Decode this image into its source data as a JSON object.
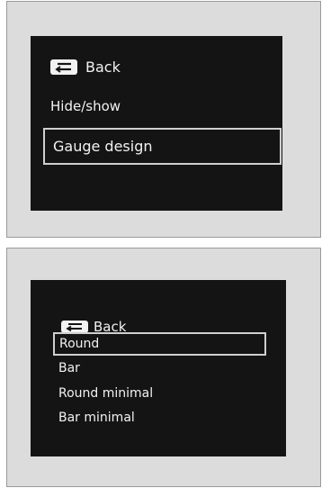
{
  "panel_1": {
    "back_label": "Back",
    "items": [
      "Hide/show",
      "Gauge design"
    ],
    "selected": "Gauge design"
  },
  "panel_2": {
    "back_label": "Back",
    "items": [
      "Round",
      "Bar",
      "Round minimal",
      "Bar minimal"
    ],
    "selected": "Round"
  },
  "icons": {
    "back": "back-arrow-icon"
  },
  "colors": {
    "screen_background": "#141414",
    "text": "#f2f2f2",
    "selection_border": "#cfcfcf",
    "panel_background": "#dcdcdc"
  }
}
